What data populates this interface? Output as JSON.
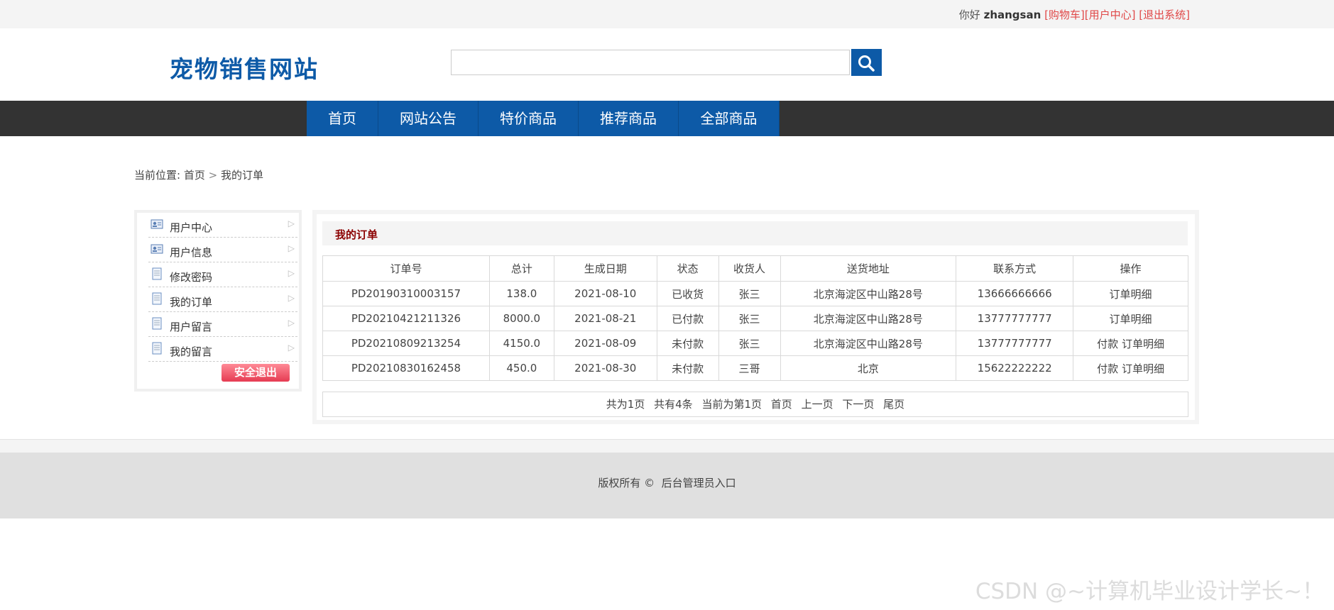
{
  "topbar": {
    "greeting": "你好",
    "username": "zhangsan",
    "cart_link": "[购物车]",
    "user_center_link": "[用户中心]",
    "logout_link": "[退出系统]"
  },
  "header": {
    "logo": "宠物销售网站",
    "search_value": ""
  },
  "nav": [
    "首页",
    "网站公告",
    "特价商品",
    "推荐商品",
    "全部商品"
  ],
  "breadcrumb": {
    "prefix": "当前位置:",
    "home": "首页",
    "separator": ">",
    "current": "我的订单"
  },
  "sidebar": {
    "items": [
      {
        "label": "用户中心",
        "icon": "user-card-icon"
      },
      {
        "label": "用户信息",
        "icon": "user-card-icon"
      },
      {
        "label": "修改密码",
        "icon": "document-icon"
      },
      {
        "label": "我的订单",
        "icon": "document-icon"
      },
      {
        "label": "用户留言",
        "icon": "document-icon"
      },
      {
        "label": "我的留言",
        "icon": "document-icon"
      }
    ],
    "arrow_icon": "chevron-right-icon",
    "logout_button": "安全退出"
  },
  "main": {
    "title": "我的订单",
    "columns": [
      "订单号",
      "总计",
      "生成日期",
      "状态",
      "收货人",
      "送货地址",
      "联系方式",
      "操作"
    ],
    "rows": [
      {
        "order_no": "PD20190310003157",
        "total": "138.0",
        "date": "2021-08-10",
        "status": "已收货",
        "receiver": "张三",
        "address": "北京海淀区中山路28号",
        "phone": "13666666666",
        "pay": "",
        "detail": "订单明细"
      },
      {
        "order_no": "PD20210421211326",
        "total": "8000.0",
        "date": "2021-08-21",
        "status": "已付款",
        "receiver": "张三",
        "address": "北京海淀区中山路28号",
        "phone": "13777777777",
        "pay": "",
        "detail": "订单明细"
      },
      {
        "order_no": "PD20210809213254",
        "total": "4150.0",
        "date": "2021-08-09",
        "status": "未付款",
        "receiver": "张三",
        "address": "北京海淀区中山路28号",
        "phone": "13777777777",
        "pay": "付款",
        "detail": "订单明细"
      },
      {
        "order_no": "PD20210830162458",
        "total": "450.0",
        "date": "2021-08-30",
        "status": "未付款",
        "receiver": "三哥",
        "address": "北京",
        "phone": "15622222222",
        "pay": "付款",
        "detail": "订单明细"
      }
    ],
    "pager": {
      "total_pages": "共为1页",
      "total_items": "共有4条",
      "current": "当前为第1页",
      "first": "首页",
      "prev": "上一页",
      "next": "下一页",
      "last": "尾页"
    }
  },
  "footer": {
    "copyright": "版权所有 ©",
    "admin_link": "后台管理员入口"
  },
  "watermark": "CSDN @~计算机毕业设计学长~！",
  "colors": {
    "brand_blue": "#0d5aa7",
    "nav_bar": "#333333",
    "link_red": "#e04848",
    "title_dark_red": "#8b0000"
  }
}
